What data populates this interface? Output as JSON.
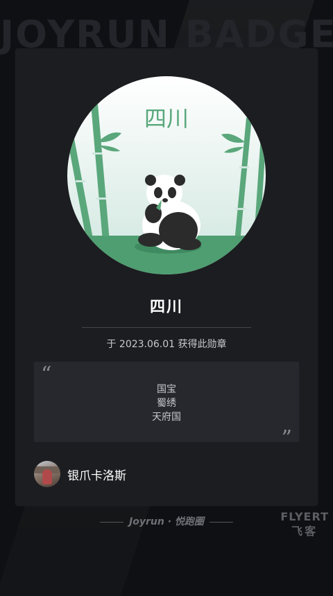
{
  "background": {
    "title": "JOYRUN BADGES"
  },
  "badge": {
    "emblem_text": "四川",
    "name": "四川",
    "earned_text": "于 2023.06.01 获得此勋章",
    "colors": {
      "bamboo": "#5aa77b",
      "sky_top": "#ffffff",
      "sky_bottom": "#cfe6df",
      "ground": "#4f9e71"
    }
  },
  "quote": {
    "open_mark": "“",
    "close_mark": "”",
    "lines": [
      "国宝",
      "蜀绣",
      "天府国"
    ]
  },
  "user": {
    "name": "银爪卡洛斯"
  },
  "footer": {
    "brand": "Joyrun · 悦跑圈"
  },
  "watermark": {
    "line1": "FLYERT",
    "line2": "飞客"
  }
}
